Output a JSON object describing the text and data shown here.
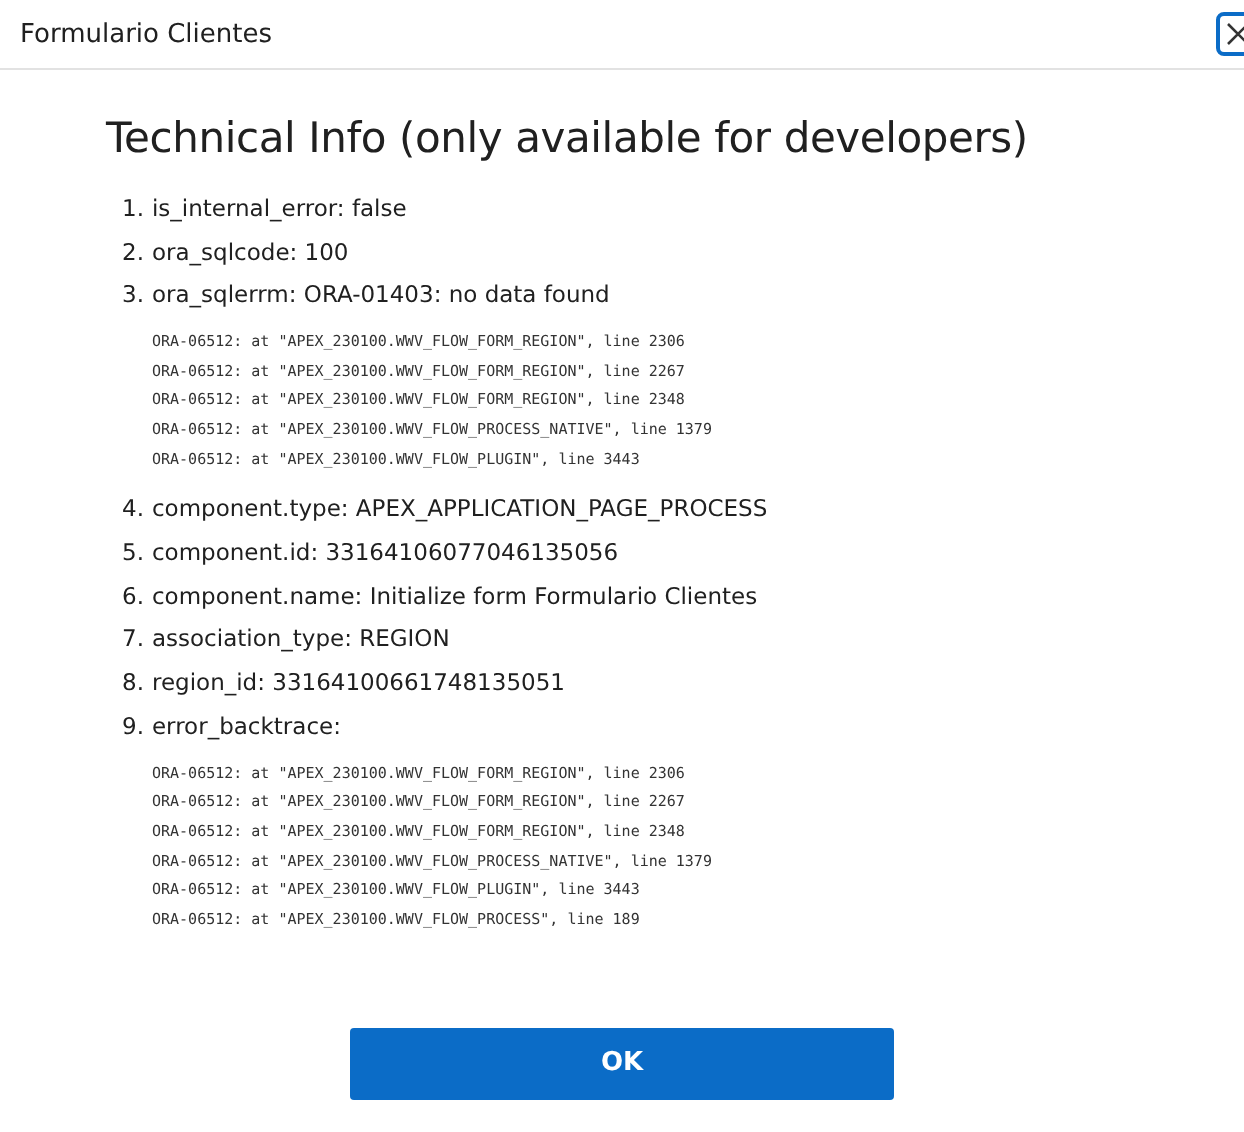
{
  "window": {
    "title": "Formulario Clientes"
  },
  "heading": "Technical Info (only available for developers)",
  "items": [
    {
      "number": "1.",
      "text": "is_internal_error: false"
    },
    {
      "number": "2.",
      "text": "ora_sqlcode: 100"
    },
    {
      "number": "3.",
      "text": "ora_sqlerrm: ORA-01403: no data found",
      "code": [
        "ORA-06512: at \"APEX_230100.WWV_FLOW_FORM_REGION\", line 2306",
        "ORA-06512: at \"APEX_230100.WWV_FLOW_FORM_REGION\", line 2267",
        "ORA-06512: at \"APEX_230100.WWV_FLOW_FORM_REGION\", line 2348",
        "ORA-06512: at \"APEX_230100.WWV_FLOW_PROCESS_NATIVE\", line 1379",
        "ORA-06512: at \"APEX_230100.WWV_FLOW_PLUGIN\", line 3443"
      ]
    },
    {
      "number": "4.",
      "text": "component.type: APEX_APPLICATION_PAGE_PROCESS"
    },
    {
      "number": "5.",
      "text": "component.id: 33164106077046135056"
    },
    {
      "number": "6.",
      "text": "component.name: Initialize form Formulario Clientes"
    },
    {
      "number": "7.",
      "text": "association_type: REGION"
    },
    {
      "number": "8.",
      "text": "region_id: 33164100661748135051"
    },
    {
      "number": "9.",
      "text": "error_backtrace:",
      "code": [
        "ORA-06512: at \"APEX_230100.WWV_FLOW_FORM_REGION\", line 2306",
        "ORA-06512: at \"APEX_230100.WWV_FLOW_FORM_REGION\", line 2267",
        "ORA-06512: at \"APEX_230100.WWV_FLOW_FORM_REGION\", line 2348",
        "ORA-06512: at \"APEX_230100.WWV_FLOW_PROCESS_NATIVE\", line 1379",
        "ORA-06512: at \"APEX_230100.WWV_FLOW_PLUGIN\", line 3443",
        "ORA-06512: at \"APEX_230100.WWV_FLOW_PROCESS\", line 189"
      ]
    }
  ],
  "ok_button": "OK"
}
